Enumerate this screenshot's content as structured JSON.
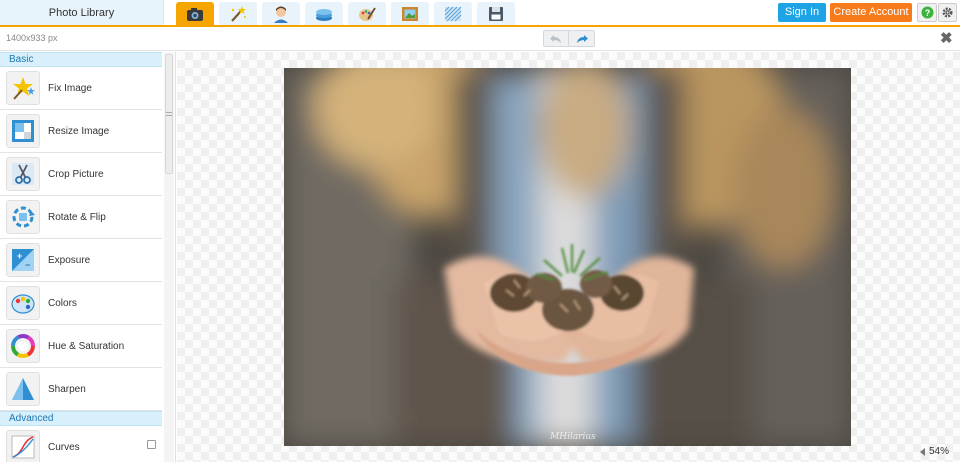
{
  "app": {
    "library_label": "Photo Library"
  },
  "toolbar": {
    "tabs": [
      {
        "icon": "camera-icon",
        "active": true
      },
      {
        "icon": "magic-wand-icon",
        "active": false
      },
      {
        "icon": "face-icon",
        "active": false
      },
      {
        "icon": "layers-icon",
        "active": false
      },
      {
        "icon": "palette-brush-icon",
        "active": false
      },
      {
        "icon": "frame-icon",
        "active": false
      },
      {
        "icon": "texture-icon",
        "active": false
      },
      {
        "icon": "save-icon",
        "active": false
      }
    ],
    "sign_in": "Sign In",
    "create_account": "Create Account",
    "help_icon": "help-icon",
    "settings_icon": "gear-icon"
  },
  "subbar": {
    "dimensions": "1400x933 px",
    "undo_icon": "undo-icon",
    "redo_icon": "redo-icon",
    "close_symbol": "✖"
  },
  "sidebar": {
    "basic_header": "Basic",
    "basic_items": [
      {
        "label": "Fix Image",
        "icon": "fix-image-icon"
      },
      {
        "label": "Resize Image",
        "icon": "resize-icon"
      },
      {
        "label": "Crop Picture",
        "icon": "crop-icon"
      },
      {
        "label": "Rotate & Flip",
        "icon": "rotate-icon"
      },
      {
        "label": "Exposure",
        "icon": "exposure-icon"
      },
      {
        "label": "Colors",
        "icon": "colors-icon"
      },
      {
        "label": "Hue & Saturation",
        "icon": "hue-saturation-icon"
      },
      {
        "label": "Sharpen",
        "icon": "sharpen-icon"
      }
    ],
    "advanced_header": "Advanced",
    "advanced_items": [
      {
        "label": "Curves",
        "icon": "curves-icon"
      }
    ]
  },
  "canvas": {
    "photo_watermark": "MHilarius",
    "zoom": "54%"
  },
  "colors": {
    "accent_orange": "#f6a400",
    "sign_in_blue": "#1ea3e6",
    "create_orange": "#f77a1b",
    "section_header_bg": "#d8f0fb"
  }
}
